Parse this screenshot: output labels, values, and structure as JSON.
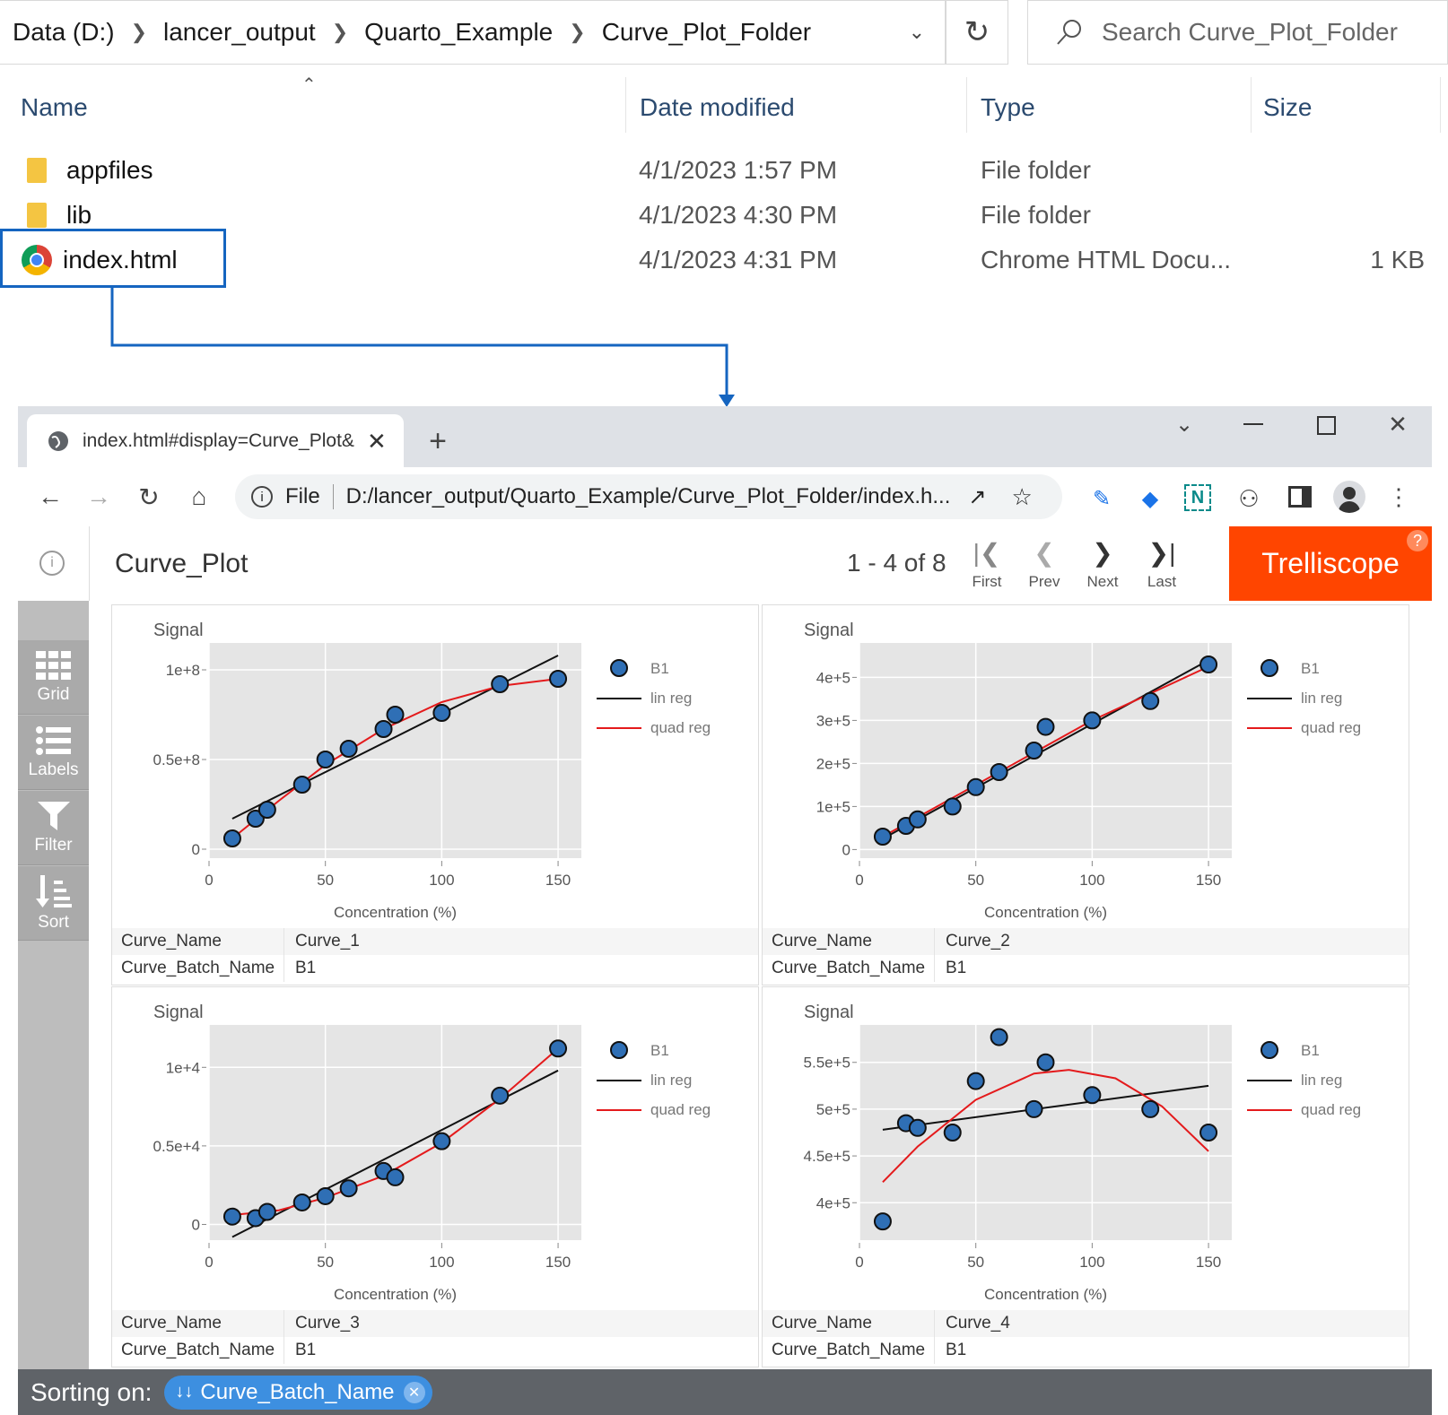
{
  "explorer": {
    "breadcrumbs": [
      "Data (D:)",
      "lancer_output",
      "Quarto_Example",
      "Curve_Plot_Folder"
    ],
    "search_placeholder": "Search Curve_Plot_Folder",
    "columns": {
      "name": "Name",
      "date": "Date modified",
      "type": "Type",
      "size": "Size"
    },
    "files": [
      {
        "name": "appfiles",
        "date": "4/1/2023 1:57 PM",
        "type": "File folder",
        "size": "",
        "icon": "folder-icon"
      },
      {
        "name": "lib",
        "date": "4/1/2023 4:30 PM",
        "type": "File folder",
        "size": "",
        "icon": "folder-icon"
      },
      {
        "name": "index.html",
        "date": "4/1/2023 4:31 PM",
        "type": "Chrome HTML Docu...",
        "size": "1 KB",
        "icon": "chrome-icon"
      }
    ]
  },
  "browser": {
    "tab_title": "index.html#display=Curve_Plot&",
    "url_scheme": "File",
    "url": "D:/lancer_output/Quarto_Example/Curve_Plot_Folder/index.h..."
  },
  "trelliscope": {
    "display_name": "Curve_Plot",
    "pagination": "1 - 4 of 8",
    "nav": {
      "first": "First",
      "prev": "Prev",
      "next": "Next",
      "last": "Last"
    },
    "brand": "Trelliscope",
    "brand_color": "#ff4500",
    "sidebar": [
      "Grid",
      "Labels",
      "Filter",
      "Sort"
    ],
    "sorting_label": "Sorting on:",
    "sort_chip": "Curve_Batch_Name",
    "meta_keys": [
      "Curve_Name",
      "Curve_Batch_Name"
    ]
  },
  "chart_data": [
    {
      "type": "scatter",
      "ylabel": "Signal",
      "xlabel": "Concentration (%)",
      "meta": {
        "Curve_Name": "Curve_1",
        "Curve_Batch_Name": "B1"
      },
      "xlim": [
        0,
        160
      ],
      "ylim": [
        -5000000.0,
        115000000.0
      ],
      "xticks": [
        0,
        50,
        100,
        150
      ],
      "yticks": [
        0,
        50000000.0,
        100000000.0
      ],
      "ytick_labels": [
        "0",
        "0.5e+8",
        "1e+8"
      ],
      "legend": [
        "B1",
        "lin reg",
        "quad reg"
      ],
      "x": [
        10,
        20,
        25,
        40,
        50,
        60,
        75,
        80,
        100,
        125,
        150
      ],
      "y": [
        6000000.0,
        17000000.0,
        22000000.0,
        36000000.0,
        50000000.0,
        56000000.0,
        67000000.0,
        75000000.0,
        76000000.0,
        92000000.0,
        95000000.0
      ],
      "lin": [
        [
          10,
          17000000.0
        ],
        [
          150,
          108000000.0
        ]
      ],
      "quad": [
        [
          10,
          6000000.0
        ],
        [
          30,
          27000000.0
        ],
        [
          50,
          47000000.0
        ],
        [
          75,
          67000000.0
        ],
        [
          100,
          82000000.0
        ],
        [
          125,
          91000000.0
        ],
        [
          150,
          95000000.0
        ]
      ]
    },
    {
      "type": "scatter",
      "ylabel": "Signal",
      "xlabel": "Concentration (%)",
      "meta": {
        "Curve_Name": "Curve_2",
        "Curve_Batch_Name": "B1"
      },
      "xlim": [
        0,
        160
      ],
      "ylim": [
        -20000.0,
        480000.0
      ],
      "xticks": [
        0,
        50,
        100,
        150
      ],
      "yticks": [
        0,
        100000.0,
        200000.0,
        300000.0,
        400000.0
      ],
      "ytick_labels": [
        "0",
        "1e+5",
        "2e+5",
        "3e+5",
        "4e+5"
      ],
      "legend": [
        "B1",
        "lin reg",
        "quad reg"
      ],
      "x": [
        10,
        20,
        25,
        40,
        50,
        60,
        75,
        80,
        100,
        125,
        150
      ],
      "y": [
        30000.0,
        55000.0,
        70000.0,
        100000.0,
        145000.0,
        180000.0,
        230000.0,
        285000.0,
        300000.0,
        345000.0,
        430000.0
      ],
      "lin": [
        [
          10,
          25000.0
        ],
        [
          150,
          440000.0
        ]
      ],
      "quad": [
        [
          10,
          30000.0
        ],
        [
          50,
          150000.0
        ],
        [
          100,
          300000.0
        ],
        [
          150,
          425000.0
        ]
      ]
    },
    {
      "type": "scatter",
      "ylabel": "Signal",
      "xlabel": "Concentration (%)",
      "meta": {
        "Curve_Name": "Curve_3",
        "Curve_Batch_Name": "B1"
      },
      "xlim": [
        0,
        160
      ],
      "ylim": [
        -1000.0,
        12700.0
      ],
      "xticks": [
        0,
        50,
        100,
        150
      ],
      "yticks": [
        0,
        5000.0,
        10000.0
      ],
      "ytick_labels": [
        "0",
        "0.5e+4",
        "1e+4"
      ],
      "legend": [
        "B1",
        "lin reg",
        "quad reg"
      ],
      "x": [
        10,
        20,
        25,
        40,
        50,
        60,
        75,
        80,
        100,
        125,
        150
      ],
      "y": [
        500.0,
        400.0,
        800.0,
        1400.0,
        1800.0,
        2300.0,
        3400.0,
        3000.0,
        5300.0,
        8200.0,
        11200.0
      ],
      "lin": [
        [
          10,
          -800.0
        ],
        [
          150,
          9800.0
        ]
      ],
      "quad": [
        [
          10,
          600.0
        ],
        [
          30,
          900.0
        ],
        [
          50,
          1700.0
        ],
        [
          75,
          3100.0
        ],
        [
          100,
          5200.0
        ],
        [
          125,
          8000.0
        ],
        [
          150,
          11200.0
        ]
      ]
    },
    {
      "type": "scatter",
      "ylabel": "Signal",
      "xlabel": "Concentration (%)",
      "meta": {
        "Curve_Name": "Curve_4",
        "Curve_Batch_Name": "B1"
      },
      "xlim": [
        0,
        160
      ],
      "ylim": [
        360000.0,
        590000.0
      ],
      "xticks": [
        0,
        50,
        100,
        150
      ],
      "yticks": [
        400000.0,
        450000.0,
        500000.0,
        550000.0
      ],
      "ytick_labels": [
        "4e+5",
        "4.5e+5",
        "5e+5",
        "5.5e+5"
      ],
      "legend": [
        "B1",
        "lin reg",
        "quad reg"
      ],
      "x": [
        10,
        20,
        25,
        40,
        50,
        60,
        75,
        80,
        100,
        125,
        150
      ],
      "y": [
        380000.0,
        485000.0,
        480000.0,
        475000.0,
        530000.0,
        577000.0,
        500000.0,
        550000.0,
        515000.0,
        500000.0,
        475000.0
      ],
      "lin": [
        [
          10,
          478000.0
        ],
        [
          150,
          525000.0
        ]
      ],
      "quad": [
        [
          10,
          422000.0
        ],
        [
          25,
          460000.0
        ],
        [
          50,
          510000.0
        ],
        [
          75,
          538000.0
        ],
        [
          90,
          542000.0
        ],
        [
          110,
          533000.0
        ],
        [
          130,
          503000.0
        ],
        [
          150,
          455000.0
        ]
      ]
    }
  ]
}
